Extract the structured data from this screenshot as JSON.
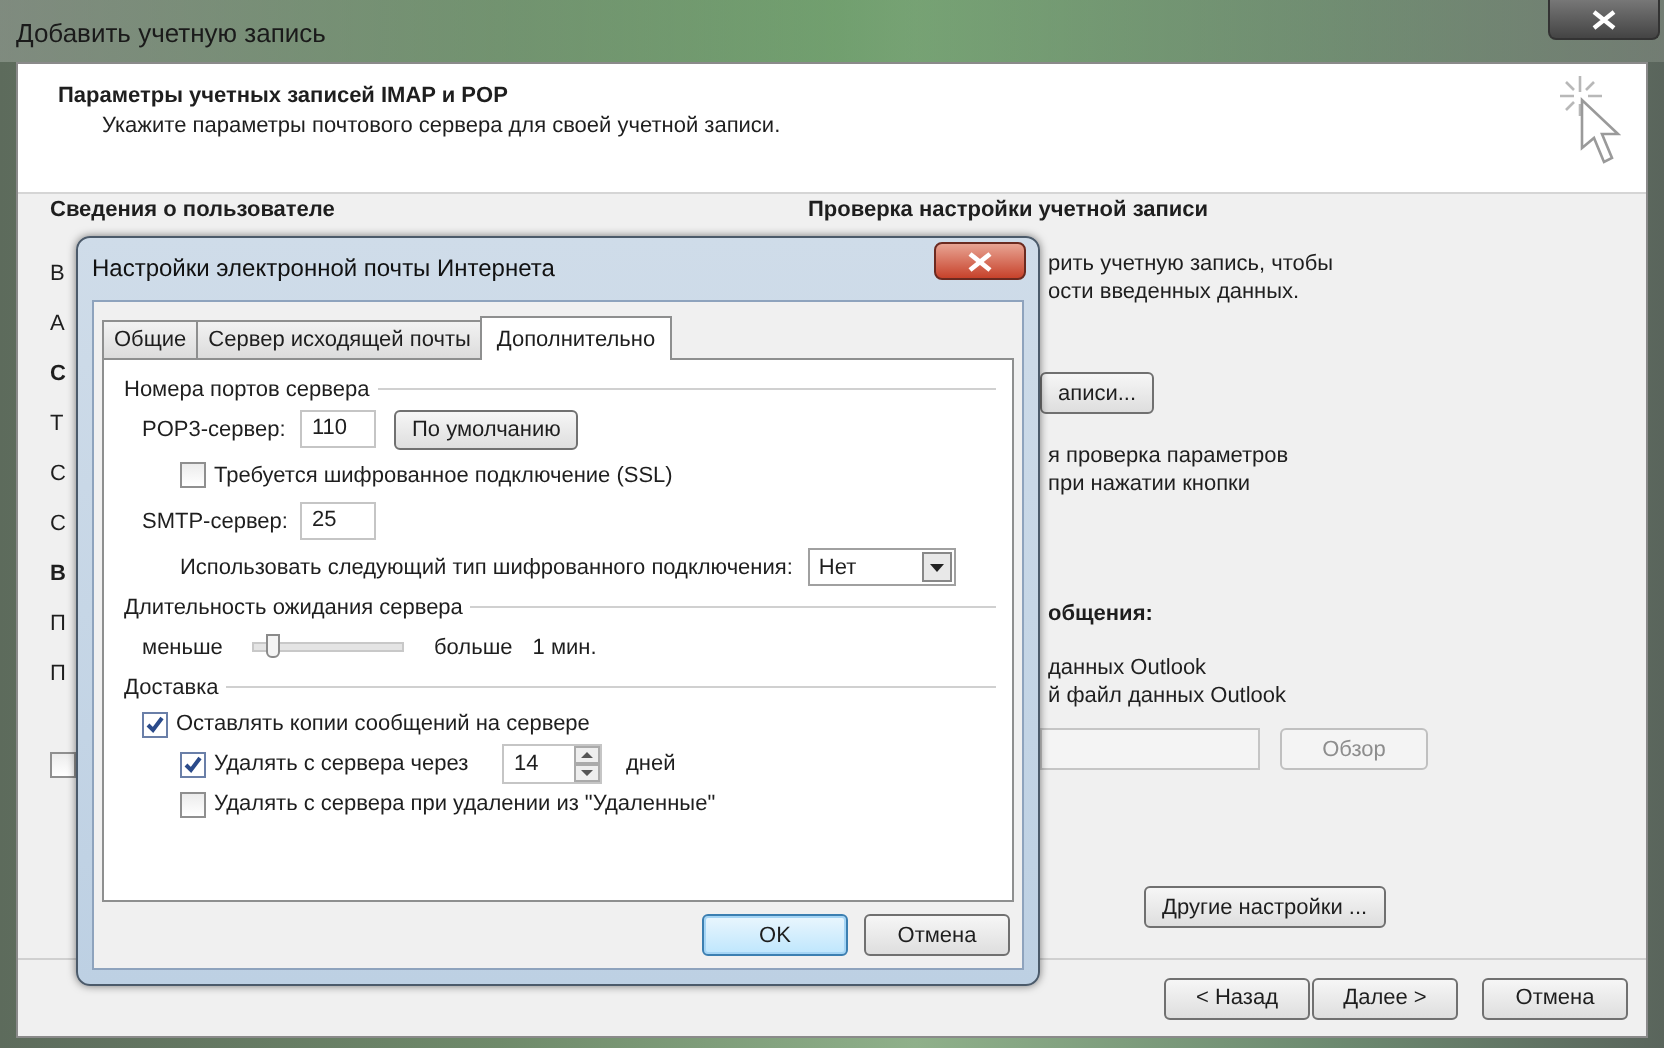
{
  "window": {
    "title": "Добавить учетную запись"
  },
  "header": {
    "title": "Параметры учетных записей IMAP и POP",
    "subtitle": "Укажите параметры почтового сервера для своей учетной записи."
  },
  "left_section": {
    "heading": "Сведения о пользователе",
    "fragments": [
      {
        "text": "В",
        "bold": false
      },
      {
        "text": "А",
        "bold": false
      },
      {
        "text": "С",
        "bold": true
      },
      {
        "text": "Т",
        "bold": false
      },
      {
        "text": "С",
        "bold": false
      },
      {
        "text": "С",
        "bold": false
      },
      {
        "text": "В",
        "bold": true
      },
      {
        "text": "П",
        "bold": false
      },
      {
        "text": "П",
        "bold": false
      }
    ],
    "checkbox": {
      "checked": false
    }
  },
  "right_section": {
    "heading": "Проверка настройки учетной записи",
    "items": [
      {
        "kind": "note",
        "lines": [
          "рить учетную запись, чтобы",
          "ости введенных данных."
        ]
      },
      {
        "kind": "button",
        "label": "аписи..."
      },
      {
        "kind": "note",
        "lines": [
          "я проверка параметров",
          "при нажатии кнопки"
        ]
      },
      {
        "kind": "label",
        "text": "общения:"
      },
      {
        "kind": "note",
        "lines": [
          "данных Outlook",
          "й файл данных Outlook"
        ]
      },
      {
        "kind": "path_row",
        "button": "Обзор",
        "disabled": true
      },
      {
        "kind": "more_button",
        "label": "Другие настройки ..."
      }
    ]
  },
  "buttons": [
    "< Назад",
    "Далее >",
    "Отмена"
  ],
  "dialog": {
    "title": "Настройки электронной почты Интернета",
    "tabs": [
      {
        "label": "Общие",
        "selected": false
      },
      {
        "label": "Сервер исходящей почты",
        "selected": false
      },
      {
        "label": "Дополнительно",
        "selected": true
      }
    ],
    "ports": {
      "heading": "Номера портов сервера",
      "pop3_label": "POP3-сервер:",
      "pop3_value": "110",
      "default_button": "По умолчанию",
      "ssl": {
        "label": "Требуется шифрованное подключение (SSL)",
        "checked": false
      },
      "smtp_label": "SMTP-сервер:",
      "smtp_value": "25",
      "encryption_label": "Использовать следующий тип шифрованного подключения:",
      "encryption_value": "Нет"
    },
    "timeout": {
      "heading": "Длительность ожидания сервера",
      "min_label": "меньше",
      "max_label": "больше",
      "level": 0.08,
      "reading": "1 мин."
    },
    "delivery": {
      "heading": "Доставка",
      "options": [
        {
          "label": "Оставлять копии сообщений на сервере",
          "checked": true,
          "kind": "plain"
        },
        {
          "label": "Удалять с сервера через",
          "checked": true,
          "kind": "days",
          "value": "14",
          "unit": "дней"
        },
        {
          "label": "Удалять с сервера при удалении из \"Удаленные\"",
          "checked": false,
          "kind": "plain"
        }
      ]
    },
    "buttons": [
      {
        "label": "OK",
        "default": true
      },
      {
        "label": "Отмена",
        "default": false
      }
    ]
  }
}
